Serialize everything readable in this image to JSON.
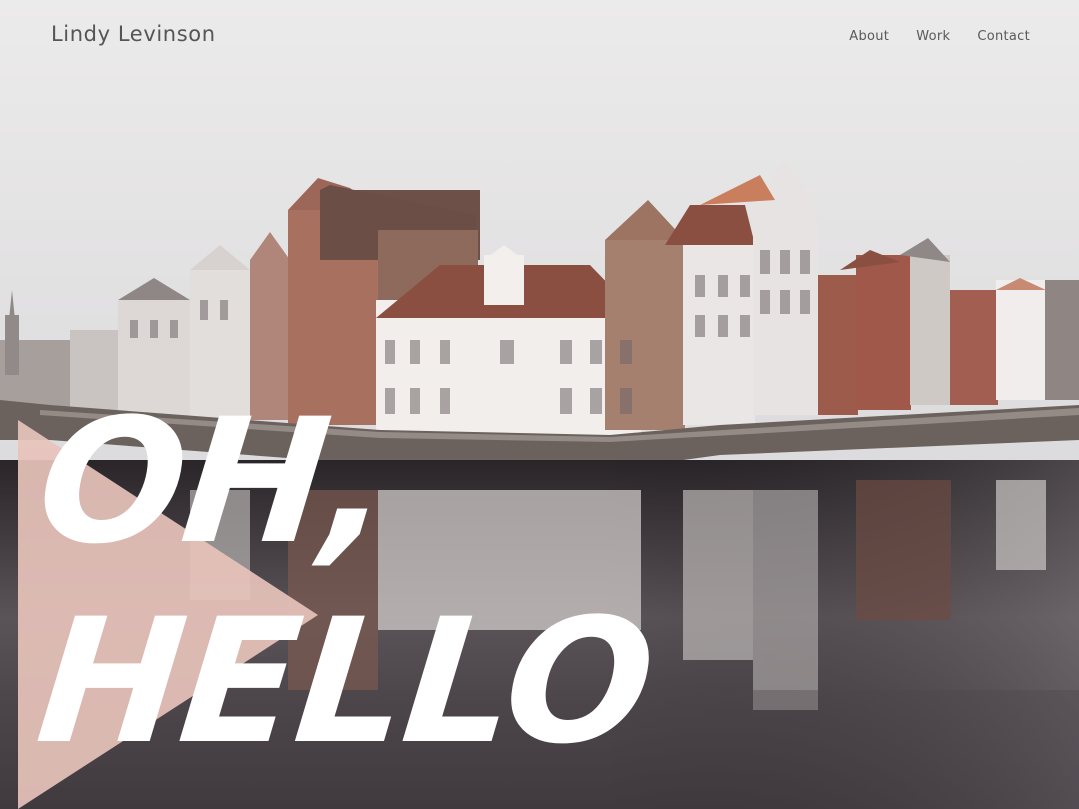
{
  "header": {
    "brand": "Lindy Levinson",
    "nav": [
      {
        "label": "About"
      },
      {
        "label": "Work"
      },
      {
        "label": "Contact"
      }
    ]
  },
  "hero": {
    "headline_line1": "OH,",
    "headline_line2": "HELLO",
    "image_icon": "canal-townhouses-photo"
  },
  "colors": {
    "sky": "#e7e5e6",
    "water": "#3f3a3f",
    "accent_triangle": "#e7c3bb",
    "headline": "#ffffff",
    "text": "#555555"
  }
}
